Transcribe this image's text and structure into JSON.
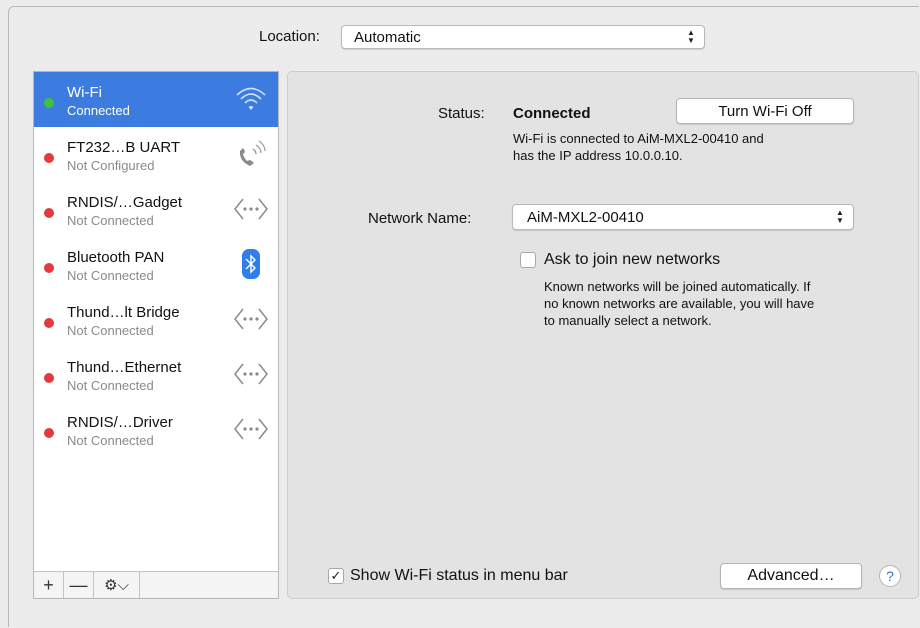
{
  "location": {
    "label": "Location:",
    "value": "Automatic"
  },
  "services": [
    {
      "name": "Wi-Fi",
      "status": "Connected",
      "dot": "green",
      "icon": "wifi-icon",
      "selected": true
    },
    {
      "name": "FT232…B UART",
      "status": "Not Configured",
      "dot": "red",
      "icon": "phone-icon"
    },
    {
      "name": "RNDIS/…Gadget",
      "status": "Not Connected",
      "dot": "red",
      "icon": "ethernet-icon"
    },
    {
      "name": "Bluetooth PAN",
      "status": "Not Connected",
      "dot": "red",
      "icon": "bluetooth-icon"
    },
    {
      "name": "Thund…lt Bridge",
      "status": "Not Connected",
      "dot": "red",
      "icon": "ethernet-icon"
    },
    {
      "name": "Thund…Ethernet",
      "status": "Not Connected",
      "dot": "red",
      "icon": "ethernet-icon"
    },
    {
      "name": "RNDIS/…Driver",
      "status": "Not Connected",
      "dot": "red",
      "icon": "ethernet-icon"
    }
  ],
  "toolbar": {
    "add": "+",
    "remove": "—",
    "gear": "⚙⌵"
  },
  "detail": {
    "status_label": "Status:",
    "status_value": "Connected",
    "turn_off_button": "Turn Wi-Fi Off",
    "status_desc_1": "Wi-Fi is connected to AiM-MXL2-00410 and",
    "status_desc_2": "has the IP address 10.0.0.10.",
    "network_name_label": "Network Name:",
    "network_name_value": "AiM-MXL2-00410",
    "ask_join_label": "Ask to join new networks",
    "ask_join_checked": false,
    "ask_desc_1": "Known networks will be joined automatically. If",
    "ask_desc_2": "no known networks are available, you will have",
    "ask_desc_3": "to manually select a network.",
    "show_status_label": "Show Wi-Fi status in menu bar",
    "show_status_checked": true,
    "advanced_button": "Advanced…",
    "help_button": "?"
  },
  "colors": {
    "selection": "#3c7ce0",
    "connected": "#3fc33b",
    "not_connected": "#e5393d",
    "bluetooth": "#2f7fe6"
  }
}
